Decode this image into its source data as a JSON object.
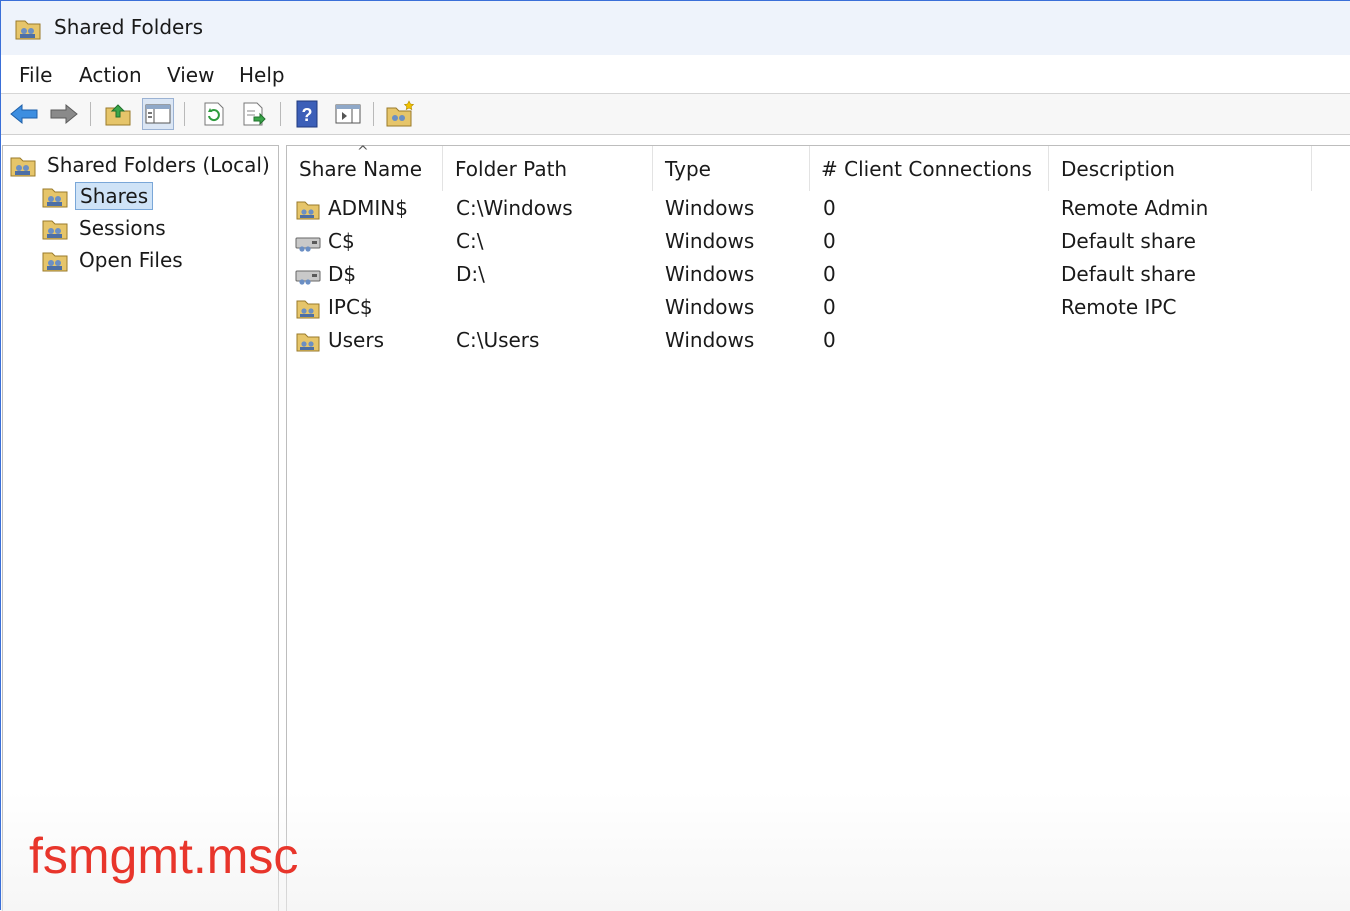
{
  "window": {
    "title": "Shared Folders",
    "app_icon": "shared-folders-icon"
  },
  "menu": [
    "File",
    "Action",
    "View",
    "Help"
  ],
  "toolbar": {
    "buttons": [
      "back-arrow-icon",
      "forward-arrow-icon",
      "up-folder-icon",
      "show-hide-console-tree-icon",
      "refresh-icon",
      "export-list-icon",
      "help-icon",
      "show-hide-action-pane-icon",
      "new-share-icon"
    ]
  },
  "tree": {
    "root": "Shared Folders (Local)",
    "children": [
      "Shares",
      "Sessions",
      "Open Files"
    ],
    "selected": "Shares"
  },
  "table": {
    "columns": [
      "Share Name",
      "Folder Path",
      "Type",
      "# Client Connections",
      "Description"
    ],
    "sort_column": "Share Name",
    "rows": [
      {
        "name": "ADMIN$",
        "path": "C:\\Windows",
        "type": "Windows",
        "connections": "0",
        "description": "Remote Admin",
        "icon": "shared-folder-icon"
      },
      {
        "name": "C$",
        "path": "C:\\",
        "type": "Windows",
        "connections": "0",
        "description": "Default share",
        "icon": "shared-drive-icon"
      },
      {
        "name": "D$",
        "path": "D:\\",
        "type": "Windows",
        "connections": "0",
        "description": "Default share",
        "icon": "shared-drive-icon"
      },
      {
        "name": "IPC$",
        "path": "",
        "type": "Windows",
        "connections": "0",
        "description": "Remote IPC",
        "icon": "shared-folder-icon"
      },
      {
        "name": "Users",
        "path": "C:\\Users",
        "type": "Windows",
        "connections": "0",
        "description": "",
        "icon": "shared-folder-icon"
      }
    ]
  },
  "overlay": {
    "caption": "fsmgmt.msc",
    "color": "#e8352b"
  }
}
